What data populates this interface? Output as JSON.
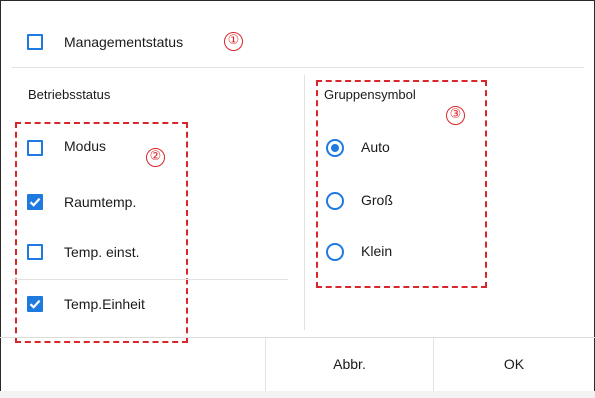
{
  "management": {
    "label": "Managementstatus",
    "checked": false,
    "marker": "①"
  },
  "operation": {
    "heading": "Betriebsstatus",
    "marker": "②",
    "items": [
      {
        "label": "Modus",
        "checked": false
      },
      {
        "label": "Raumtemp.",
        "checked": true
      },
      {
        "label": "Temp. einst.",
        "checked": false
      },
      {
        "label": "Temp.Einheit",
        "checked": true
      }
    ]
  },
  "group_icon": {
    "heading": "Gruppensymbol",
    "marker": "③",
    "options": [
      {
        "label": "Auto",
        "selected": true
      },
      {
        "label": "Groß",
        "selected": false
      },
      {
        "label": "Klein",
        "selected": false
      }
    ]
  },
  "footer": {
    "cancel_label": "Abbr.",
    "ok_label": "OK"
  },
  "colors": {
    "accent": "#1f7ae0",
    "annotation": "#d9262b"
  }
}
